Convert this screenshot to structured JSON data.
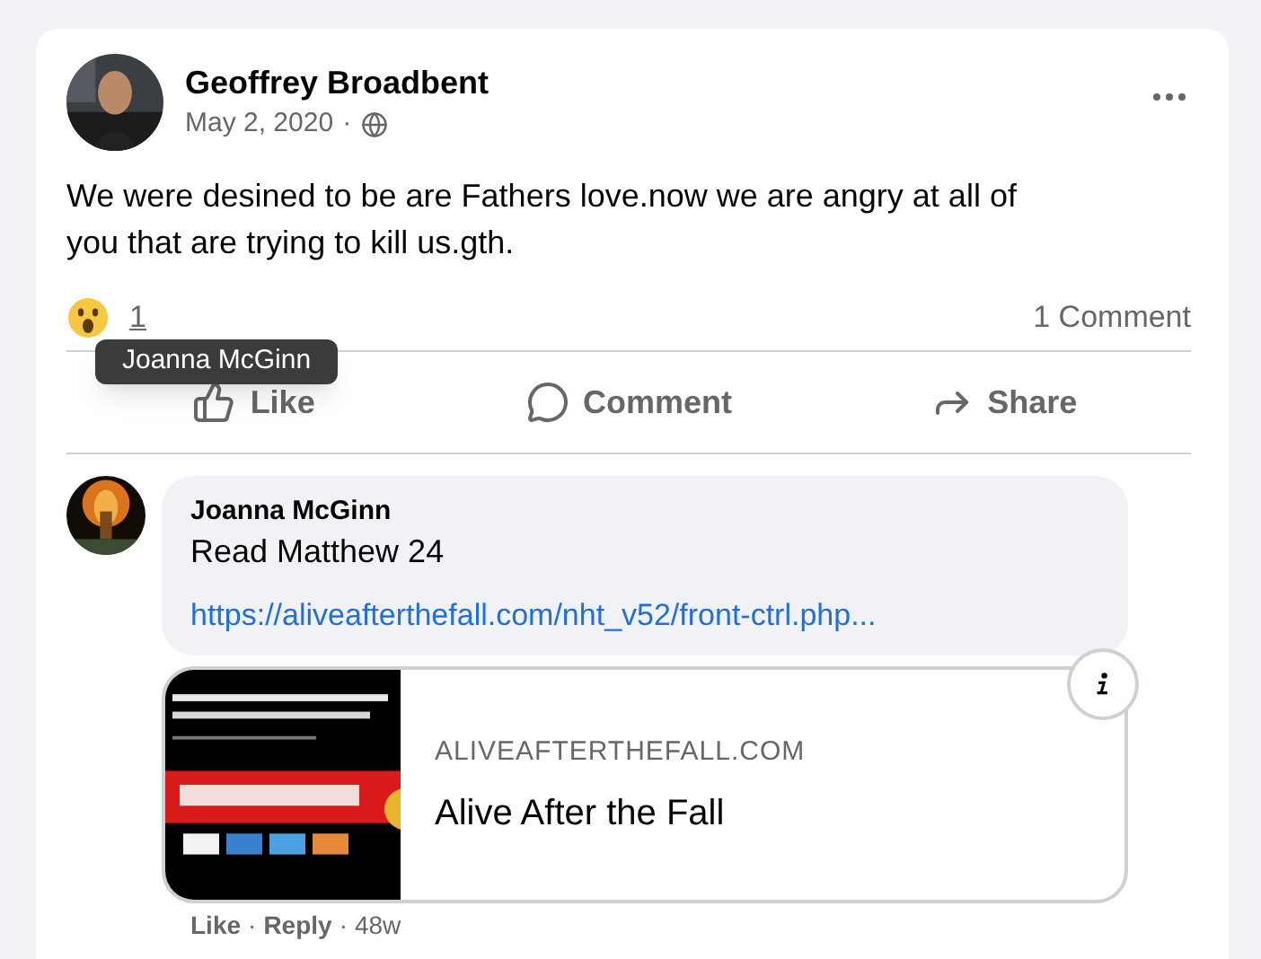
{
  "post": {
    "author": "Geoffrey Broadbent",
    "date": "May 2, 2020",
    "separator": "·",
    "text": "We were desined to be are Fathers love.now we are angry at all of you that are trying to kill us.gth.",
    "reaction_count": "1",
    "comment_count": "1 Comment"
  },
  "actions": [
    {
      "kind": "like",
      "label": "Like"
    },
    {
      "kind": "comment",
      "label": "Comment"
    },
    {
      "kind": "share",
      "label": "Share"
    }
  ],
  "tooltip": "Joanna McGinn",
  "comment": {
    "author": "Joanna McGinn",
    "text": "Read Matthew 24",
    "link": "https://aliveafterthefall.com/nht_v52/front-ctrl.php...",
    "preview": {
      "kind": "picture",
      "domain": "ALIVEAFTERTHEFALL.COM",
      "title": "Alive After the Fall"
    },
    "footer": [
      {
        "kind": "link",
        "label": "Like"
      },
      {
        "kind": "sep",
        "label": "·"
      },
      {
        "kind": "link",
        "label": "Reply"
      },
      {
        "kind": "sep",
        "label": "·"
      },
      {
        "kind": "time",
        "label": "48w"
      }
    ]
  }
}
